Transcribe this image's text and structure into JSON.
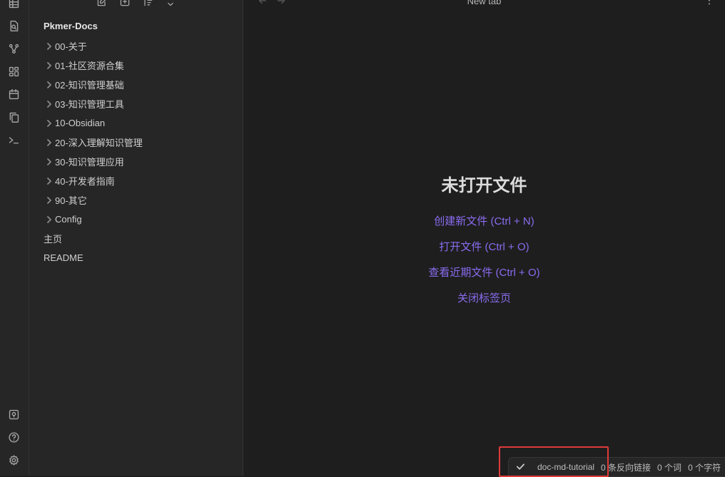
{
  "ribbon": {
    "icons": [
      "table-icon",
      "file-search-icon",
      "graph-icon",
      "dashboard-icon",
      "calendar-icon",
      "copy-icon",
      "terminal-icon",
      "vault-switcher-icon",
      "help-icon",
      "settings-icon"
    ]
  },
  "sidebar": {
    "vault_name": "Pkmer-Docs",
    "nav_icons": [
      "new-note-icon",
      "new-folder-icon",
      "sort-icon",
      "collapse-all-icon"
    ],
    "folders": [
      "00-关于",
      "01-社区资源合集",
      "02-知识管理基础",
      "03-知识管理工具",
      "10-Obsidian",
      "20-深入理解知识管理",
      "30-知识管理应用",
      "40-开发者指南",
      "90-其它",
      "Config"
    ],
    "files": [
      "主页",
      "README"
    ]
  },
  "main": {
    "tab_title": "New tab",
    "empty_title": "未打开文件",
    "actions": [
      "创建新文件 (Ctrl + N)",
      "打开文件 (Ctrl + O)",
      "查看近期文件 (Ctrl + O)",
      "关闭标签页"
    ],
    "more_glyph": "⋮"
  },
  "status_bar": {
    "branch": "doc-md-tutorial",
    "backlinks": "0 条反向链接",
    "words": "0 个词",
    "chars": "0 个字符"
  },
  "colors": {
    "accent": "#8a6cf0",
    "highlight": "#e03a3a",
    "background": "#1e1e1e",
    "sidebar": "#262626"
  }
}
